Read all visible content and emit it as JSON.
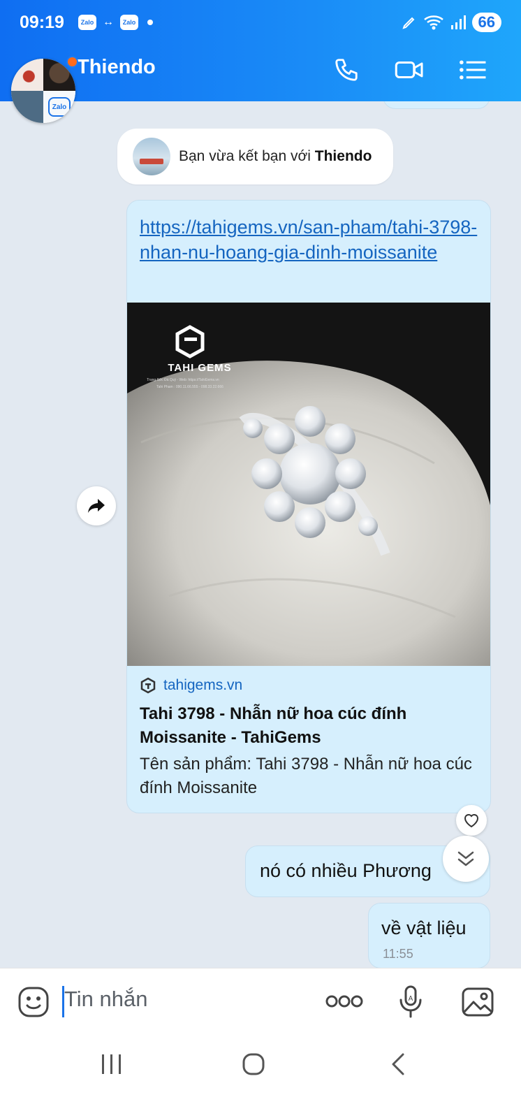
{
  "status_bar": {
    "time": "09:19",
    "app_badge_1": "Zalo",
    "app_badge_2": "Zalo",
    "link_arrows": "↔",
    "battery": "66"
  },
  "header": {
    "contact_name": "Thiendo",
    "avatar_badge": "Zalo",
    "icons": [
      "phone-icon",
      "video-call-icon",
      "menu-icon"
    ],
    "colors": {
      "gradient_start": "#0f6ef2",
      "gradient_end": "#1fa6fb",
      "online_dot": "#ff6b1a"
    }
  },
  "system_note": {
    "prefix": "Bạn vừa kết bạn với",
    "name": "Thiendo"
  },
  "link_message": {
    "url": "https://tahigems.vn/san-pham/tahi-3798-nhan-nu-hoang-gia-dinh-moissanite",
    "image": {
      "brand": "TAHI GEMS",
      "line1": "Trang Sức Đá Quý - Web: https://TahiGems.vn",
      "line2": "Tahi Pham : 090.11.66.555 - 098.33.22.666"
    },
    "preview": {
      "site": "tahigems.vn",
      "title": "Tahi 3798 - Nhẫn nữ hoa cúc đính Moissanite - TahiGems",
      "description": "Tên sản phẩm: Tahi 3798 - Nhẫn nữ hoa cúc đính Moissanite"
    }
  },
  "messages": [
    {
      "text": "nó có nhiều Phương",
      "time": ""
    },
    {
      "text": "về vật liệu",
      "time": "11:55"
    }
  ],
  "input": {
    "placeholder": "Tin nhắn",
    "icons": [
      "emoji-icon",
      "more-icon",
      "voice-icon",
      "image-icon"
    ]
  },
  "nav": [
    "recent-apps-icon",
    "home-icon",
    "back-icon"
  ]
}
